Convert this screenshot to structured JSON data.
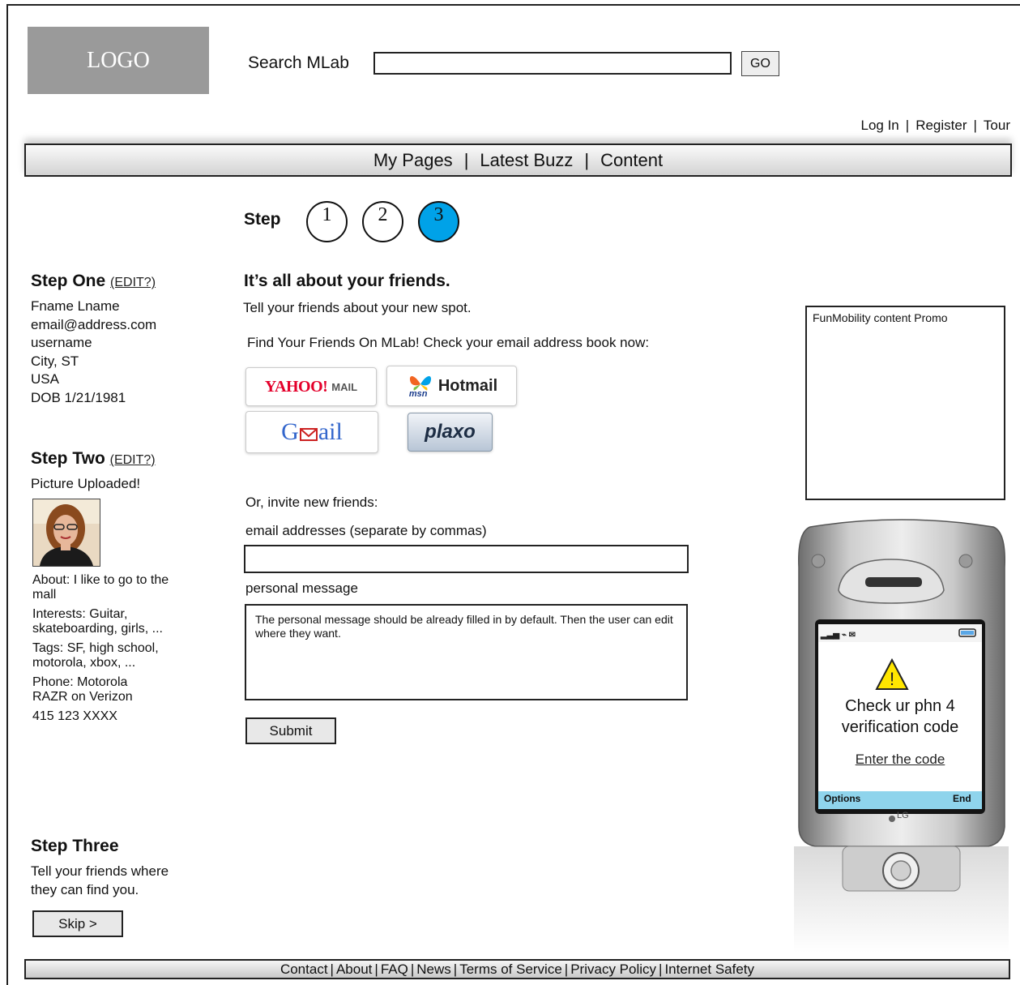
{
  "header": {
    "logo": "LOGO",
    "search_label": "Search MLab",
    "search_value": "",
    "go_label": "GO",
    "links": [
      "Log In",
      "Register",
      "Tour"
    ]
  },
  "nav": {
    "items": [
      "My Pages",
      "Latest Buzz",
      "Content"
    ]
  },
  "steps": {
    "label": "Step",
    "numbers": [
      "1",
      "2",
      "3"
    ],
    "active": 3,
    "active_color": "#00a2e8"
  },
  "sidebar": {
    "step_one": {
      "title": "Step One",
      "edit": "(EDIT?)",
      "lines": [
        "Fname Lname",
        "email@address.com",
        "username",
        "City, ST",
        "USA",
        "DOB 1/21/1981"
      ]
    },
    "step_two": {
      "title": "Step Two",
      "edit": "(EDIT?)",
      "picture_status": "Picture Uploaded!",
      "about": "About: I like to go to the mall",
      "interests": "Interests: Guitar, skateboarding, girls, ...",
      "tags": "Tags: SF, high school, motorola, xbox, ...",
      "phone": "Phone: Motorola RAZR on Verizon",
      "number": "415 123 XXXX"
    },
    "step_three": {
      "title": "Step Three",
      "text": "Tell your friends where they can find you.",
      "skip_label": "Skip >"
    }
  },
  "main": {
    "heading": "It’s all about your friends.",
    "subheading": "Tell your friends about your new spot.",
    "find_text": "Find Your Friends On MLab! Check your email address book now:",
    "providers": {
      "yahoo": "YAHOO!",
      "yahoo_mail": "MAIL",
      "msn": "msn",
      "hotmail": "Hotmail",
      "gmail_g": "G",
      "gmail_rest": "ail",
      "plaxo": "plaxo"
    },
    "invite_text": "Or, invite new friends:",
    "email_label": "email addresses (separate by commas)",
    "email_value": "",
    "message_label": "personal message",
    "message_value": "The personal message should be already filled in by default. Then the user can edit where they want.",
    "submit_label": "Submit"
  },
  "promo": {
    "title": "FunMobility content Promo"
  },
  "phone": {
    "message": "Check ur phn 4 verification code",
    "link": "Enter the code",
    "softkey_left": "Options",
    "softkey_right": "End",
    "brand": "LG"
  },
  "footer": {
    "links": [
      "Contact",
      "About",
      "FAQ",
      "News",
      "Terms of Service",
      "Privacy Policy",
      "Internet Safety"
    ]
  }
}
